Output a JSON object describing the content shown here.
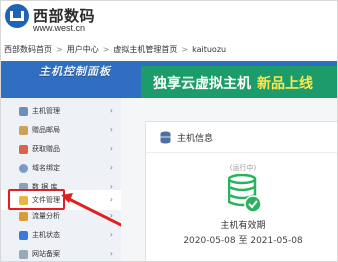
{
  "logo": {
    "title": "西部数码",
    "url": "www.west.cn"
  },
  "breadcrumb": {
    "items": [
      "西部数码首页",
      "用户中心",
      "虚拟主机管理首页",
      "kaituozu"
    ],
    "separator": ">"
  },
  "sidebar": {
    "title": "主机控制面板",
    "items": [
      {
        "label": "主机管理",
        "icon": "monitor-icon"
      },
      {
        "label": "赠品邮局",
        "icon": "mail-icon"
      },
      {
        "label": "获取赠品",
        "icon": "gift-icon"
      },
      {
        "label": "域名绑定",
        "icon": "globe-icon"
      },
      {
        "label": "数 据 库",
        "icon": "database-icon"
      },
      {
        "label": "文件管理",
        "icon": "folder-icon"
      },
      {
        "label": "流量分析",
        "icon": "chart-icon"
      },
      {
        "label": "主机状态",
        "icon": "status-icon"
      },
      {
        "label": "网站备案",
        "icon": "record-icon"
      }
    ],
    "highlighted_item": "文件管理"
  },
  "promo": {
    "text": "独享云虚拟主机",
    "highlight": "新品上线"
  },
  "card": {
    "title": "主机信息",
    "status": "(运行中)",
    "validity_label": "主机有效期",
    "validity_range": "2020-05-08 至 2021-05-08"
  },
  "colors": {
    "banner_blue": "#2f6ec0",
    "promo_green": "#1c9c6a",
    "promo_highlight": "#ffe64b",
    "db_icon_green": "#29b35e",
    "annotation_red": "#e02020"
  }
}
